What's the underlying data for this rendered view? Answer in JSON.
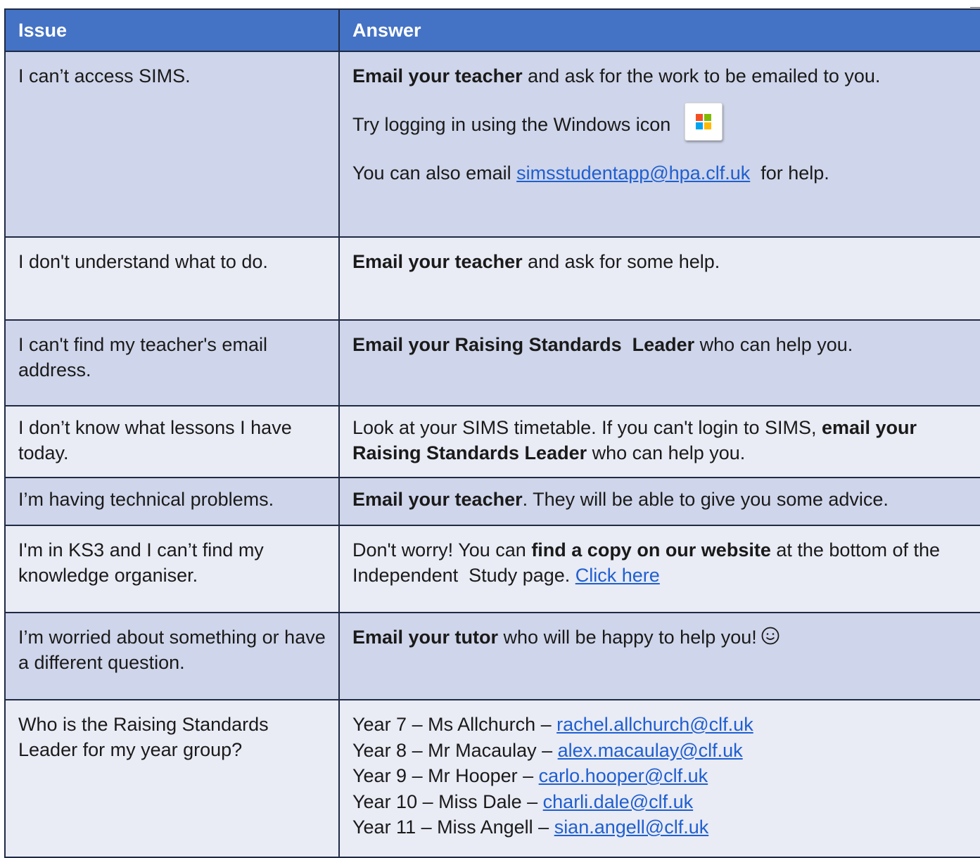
{
  "header": {
    "issue": "Issue",
    "answer": "Answer"
  },
  "rows": [
    {
      "issue": "I can’t access SIMS.",
      "answer": {
        "line1_bold": "Email your teacher",
        "line1_rest": " and ask for the work to be emailed to you.",
        "line2": "Try logging in using the Windows icon",
        "line3_pre": "You can also email ",
        "line3_link": "simsstudentapp@hpa.clf.uk",
        "line3_post": "  for help.",
        "icon": "windows-logo-icon"
      }
    },
    {
      "issue": "I don't understand what to do.",
      "answer": {
        "bold": "Email your teacher",
        "rest": " and ask for some help."
      }
    },
    {
      "issue": "I can't find my teacher's email address.",
      "answer": {
        "bold": "Email your Raising Standards  Leader",
        "rest": " who can help you."
      }
    },
    {
      "issue": "I don’t know what lessons I have today.",
      "answer": {
        "pre": "Look at your SIMS timetable. If you can't login to SIMS, ",
        "bold": "email your Raising Standards Leader",
        "rest": " who can help you."
      }
    },
    {
      "issue": "I’m having technical problems.",
      "answer": {
        "bold": "Email your teacher",
        "rest": ". They will be able to give you some advice."
      }
    },
    {
      "issue": "I'm in KS3 and I can’t find my knowledge organiser.",
      "answer": {
        "pre": "Don't worry! You can ",
        "bold": "find a copy on our website",
        "rest": " at the bottom of the Independent  Study page. ",
        "link": "Click here"
      }
    },
    {
      "issue": "I’m worried about something or have a different question.",
      "answer": {
        "bold": "Email your tutor",
        "rest": " who will be happy to help you!",
        "icon": "smiley-face-icon"
      }
    },
    {
      "issue": "Who is the Raising Standards Leader for my year group?",
      "answer": {
        "leaders": [
          {
            "label": "Year 7 – Ms Allchurch – ",
            "email": "rachel.allchurch@clf.uk"
          },
          {
            "label": "Year 8 – Mr Macaulay – ",
            "email": "alex.macaulay@clf.uk"
          },
          {
            "label": "Year 9 – Mr Hooper – ",
            "email": "carlo.hooper@clf.uk"
          },
          {
            "label": "Year 10 – Miss Dale – ",
            "email": "charli.dale@clf.uk"
          },
          {
            "label": "Year 11 – Miss Angell – ",
            "email": "sian.angell@clf.uk"
          }
        ]
      }
    }
  ],
  "colors": {
    "header_bg": "#4472c4",
    "row_shade": "#cfd5ea",
    "row_light": "#e9ebf5",
    "link": "#1f5fd0"
  }
}
